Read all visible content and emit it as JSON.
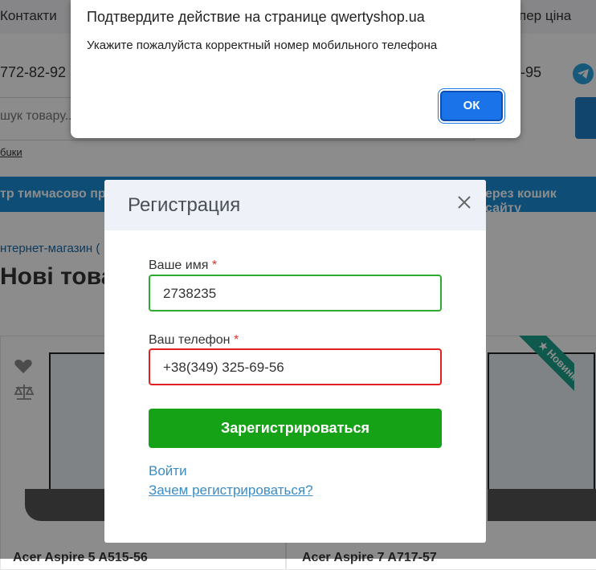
{
  "background": {
    "nav_left": "Контакти",
    "nav_right": "пер ціна",
    "phone_left": "772-82-92",
    "phone_right": "-95",
    "search_placeholder": "шук товару...",
    "small_link": "бuки",
    "banner_left": "тр тимчасово пра",
    "banner_right": "ерез кошик сайту",
    "breadcrumb": "нтернет-магазин (",
    "page_heading": "Нові това",
    "new_badge": "★ Новинка",
    "card1_title": "Acer Aspire 5 A515-56",
    "card2_title": "Acer Aspire 7 A717-57"
  },
  "alert": {
    "title": "Подтвердите действие на странице qwertyshop.ua",
    "message": "Укажите пожалуйста корректный номер мобильного телефона",
    "ok_label": "ОК"
  },
  "modal": {
    "title": "Регистрация",
    "name_label": "Ваше имя",
    "name_value": "2738235",
    "phone_label": "Ваш телефон",
    "phone_value": "+38(349) 325-69-56",
    "required_mark": "*",
    "register_label": "Зарегистрироваться",
    "login_link": "Войти",
    "why_link": "Зачем регистрироваться?"
  },
  "colors": {
    "accent_blue": "#1a8ed8",
    "register_green": "#16a216",
    "error_red": "#e02020",
    "valid_green": "#2eaa2e",
    "link_blue": "#3a8cc4"
  }
}
